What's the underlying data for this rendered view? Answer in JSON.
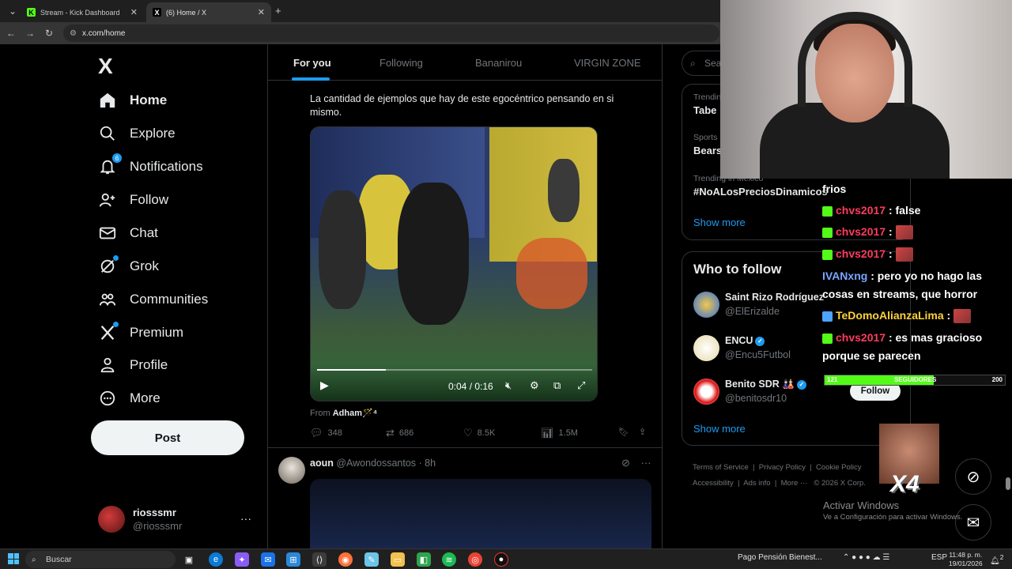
{
  "browser": {
    "tabs": [
      {
        "label": "Stream - Kick Dashboard",
        "favicon": "K"
      },
      {
        "label": "(6) Home / X",
        "favicon": "X"
      }
    ],
    "url": "x.com/home"
  },
  "sidebar": {
    "logo": "X",
    "nav": [
      {
        "label": "Home",
        "icon": "home-icon"
      },
      {
        "label": "Explore",
        "icon": "search-icon"
      },
      {
        "label": "Notifications",
        "icon": "bell-icon",
        "badge": "6"
      },
      {
        "label": "Follow",
        "icon": "person-plus-icon"
      },
      {
        "label": "Chat",
        "icon": "mail-icon"
      },
      {
        "label": "Grok",
        "icon": "grok-icon"
      },
      {
        "label": "Communities",
        "icon": "people-icon"
      },
      {
        "label": "Premium",
        "icon": "x-icon"
      },
      {
        "label": "Profile",
        "icon": "person-icon"
      },
      {
        "label": "More",
        "icon": "more-circle-icon"
      }
    ],
    "post_button": "Post",
    "account": {
      "name": "riosssmr",
      "handle": "@riosssmr"
    }
  },
  "feed": {
    "tabs": [
      "For you",
      "Following",
      "Bananirou",
      "VIRGIN ZONE"
    ],
    "tweet": {
      "text": "La cantidad de ejemplos que hay de este egocéntrico pensando en si mismo.",
      "video": {
        "time": "0:04 / 0:16",
        "progress": 0.25
      },
      "from_prefix": "From",
      "from_name": "Adham🪄⁴",
      "replies": "348",
      "retweets": "686",
      "likes": "8.5K",
      "views": "1.5M"
    },
    "tweet2": {
      "name": "aoun",
      "handle": "@Awondossantos",
      "time": "· 8h"
    }
  },
  "right": {
    "search_placeholder": "Search",
    "trends": [
      {
        "context": "Trending",
        "name": "Tabe"
      },
      {
        "context": "Sports",
        "name": "Bears"
      },
      {
        "context": "Trending in Mexico",
        "name": "#NoALosPreciosDinamicos"
      }
    ],
    "show_more": "Show more",
    "who_to_follow": {
      "title": "Who to follow",
      "users": [
        {
          "name": "Saint Rizo Rodríguez",
          "handle": "@ElErizalde",
          "verified": false
        },
        {
          "name": "ENCU",
          "handle": "@Encu5Futbol",
          "verified": true
        },
        {
          "name": "Benito SDR 🎎",
          "handle": "@benitosdr10",
          "verified": true
        }
      ],
      "follow_label": "Follow",
      "show_more": "Show more"
    },
    "footer": [
      "Terms of Service",
      "Privacy Policy",
      "Cookie Policy",
      "Accessibility",
      "Ads info",
      "More ···",
      "© 2026 X Corp."
    ]
  },
  "stream_overlay": {
    "chat": [
      {
        "user": "",
        "msg": "frios",
        "color": "red"
      },
      {
        "user": "chvs2017",
        "msg": ": false",
        "color": "red"
      },
      {
        "user": "chvs2017",
        "msg": ":",
        "color": "red",
        "emote": true
      },
      {
        "user": "chvs2017",
        "msg": ":",
        "color": "red",
        "emote": true
      },
      {
        "user": "IVANxng",
        "msg": ": pero yo no hago las cosas en streams, que horror",
        "color": "blue"
      },
      {
        "user": "TeDomoAlianzaLima",
        "msg": ":",
        "color": "yellow",
        "emote": true
      },
      {
        "user": "chvs2017",
        "msg": ": es mas gracioso porque se parecen",
        "color": "red"
      }
    ],
    "followers": {
      "label": "SEGUIDORES",
      "current": "121",
      "goal": "200",
      "fraction": 0.605
    },
    "multiplier": "X4",
    "watermark_title": "Activar Windows",
    "watermark_sub": "Ve a Configuración para activar Windows."
  },
  "taskbar": {
    "search": "Buscar",
    "news": "Pago Pensión Bienest...",
    "lang": "ESP",
    "time": "11:48 p. m.",
    "date": "19/01/2026",
    "notif_count": "2"
  }
}
